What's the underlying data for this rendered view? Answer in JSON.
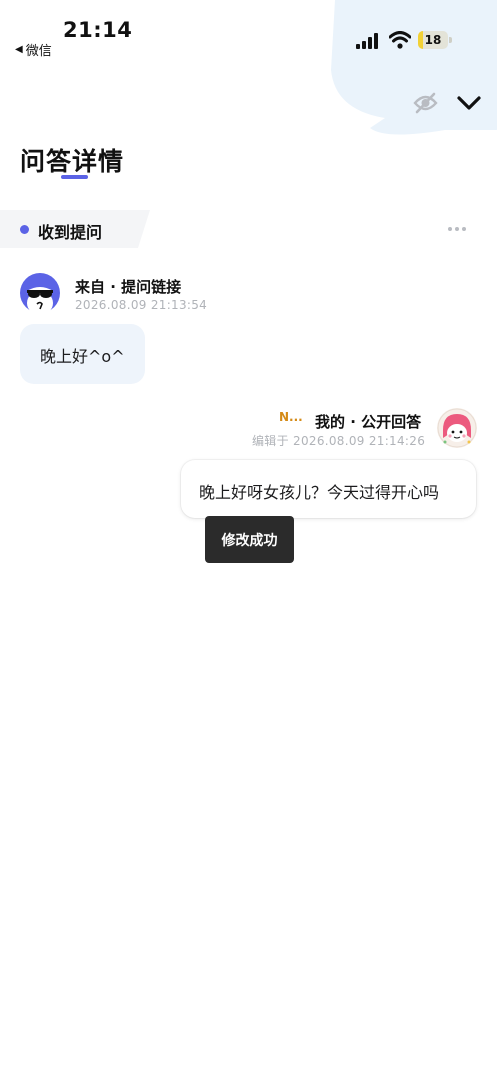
{
  "status_bar": {
    "time": "21:14",
    "back_app": "微信",
    "battery": 18
  },
  "header": {
    "title": "问答详情"
  },
  "section": {
    "label": "收到提问"
  },
  "question": {
    "sender": "来自 · 提问链接",
    "timestamp": "2026.08.09 21:13:54",
    "text": "晚上好^o^"
  },
  "answer": {
    "brand_tag": "N...",
    "sender": "我的 · 公开回答",
    "timestamp": "编辑于 2026.08.09 21:14:26",
    "text": "晚上好呀女孩儿？今天过得开心吗"
  },
  "toast": {
    "text": "修改成功"
  },
  "colors": {
    "accent": "#5b63e6",
    "blob": "#eaf3fb",
    "bubble_question": "#eef4fb",
    "brand_tag": "#d48a16",
    "toast_bg": "#2b2b2b",
    "battery_fill": "#f2d135"
  },
  "icons": {
    "header_left": "eye-off-icon",
    "header_right": "chevron-down-icon",
    "section_menu": "more-dots-icon"
  }
}
